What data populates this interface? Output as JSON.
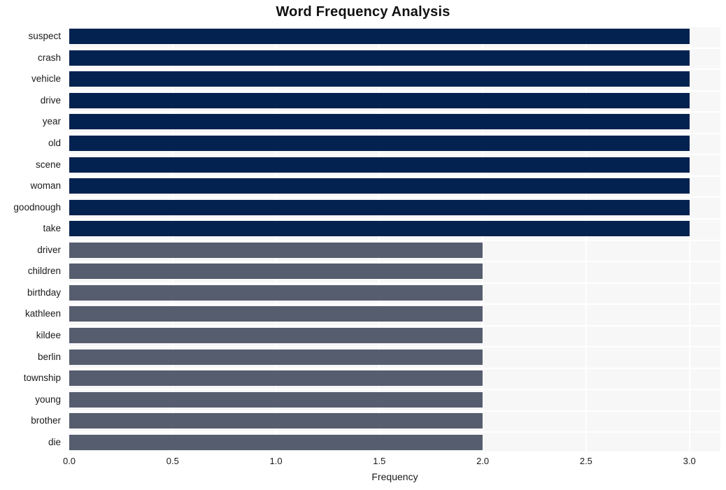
{
  "chart_data": {
    "type": "bar",
    "orientation": "horizontal",
    "title": "Word Frequency Analysis",
    "xlabel": "Frequency",
    "ylabel": "",
    "categories": [
      "suspect",
      "crash",
      "vehicle",
      "drive",
      "year",
      "old",
      "scene",
      "woman",
      "goodnough",
      "take",
      "driver",
      "children",
      "birthday",
      "kathleen",
      "kildee",
      "berlin",
      "township",
      "young",
      "brother",
      "die"
    ],
    "values": [
      3,
      3,
      3,
      3,
      3,
      3,
      3,
      3,
      3,
      3,
      2,
      2,
      2,
      2,
      2,
      2,
      2,
      2,
      2,
      2
    ],
    "bar_colors": [
      "#04224f",
      "#04224f",
      "#04224f",
      "#04224f",
      "#04224f",
      "#04224f",
      "#04224f",
      "#04224f",
      "#04224f",
      "#04224f",
      "#565d6e",
      "#565d6e",
      "#565d6e",
      "#565d6e",
      "#565d6e",
      "#565d6e",
      "#565d6e",
      "#565d6e",
      "#565d6e",
      "#565d6e"
    ],
    "xlim": [
      0.0,
      3.15
    ],
    "xticks": [
      "0.0",
      "0.5",
      "1.0",
      "1.5",
      "2.0",
      "2.5",
      "3.0"
    ],
    "xtick_values": [
      0.0,
      0.5,
      1.0,
      1.5,
      2.0,
      2.5,
      3.0
    ],
    "grid": true,
    "grid_color": "#ffffff",
    "plot_background": "#f7f7f8",
    "figure_background": "#ffffff",
    "legend": null
  }
}
